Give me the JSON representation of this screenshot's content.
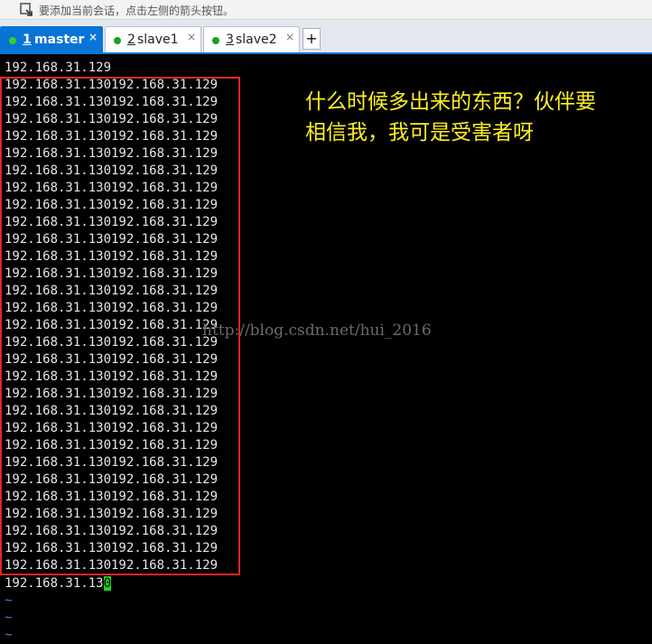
{
  "hint_bar": {
    "icon": "session-arrow-icon",
    "text": "要添加当前会话，点击左侧的箭头按钮。"
  },
  "tabs": [
    {
      "number": "1",
      "label": "master",
      "active": true,
      "close": "×",
      "status_color": "#2fd12f"
    },
    {
      "number": "2",
      "label": "slave1",
      "active": false,
      "close": "×",
      "status_color": "#1aa01a"
    },
    {
      "number": "3",
      "label": "slave2",
      "active": false,
      "close": "×",
      "status_color": "#1aa01a"
    }
  ],
  "add_tab_label": "+",
  "terminal": {
    "first_line": "192.168.31.129",
    "repeated_line": "192.168.31.130192.168.31.129",
    "repeated_count": 29,
    "last_line_prefix": "192.168.31.13",
    "cursor_char": "0",
    "tilde": "~"
  },
  "annotation": {
    "line1": "什么时候多出来的东西？伙伴要",
    "line2": "相信我，我可是受害者呀",
    "color": "#ffef22"
  },
  "watermark": "http://blog.csdn.net/hui_2016"
}
